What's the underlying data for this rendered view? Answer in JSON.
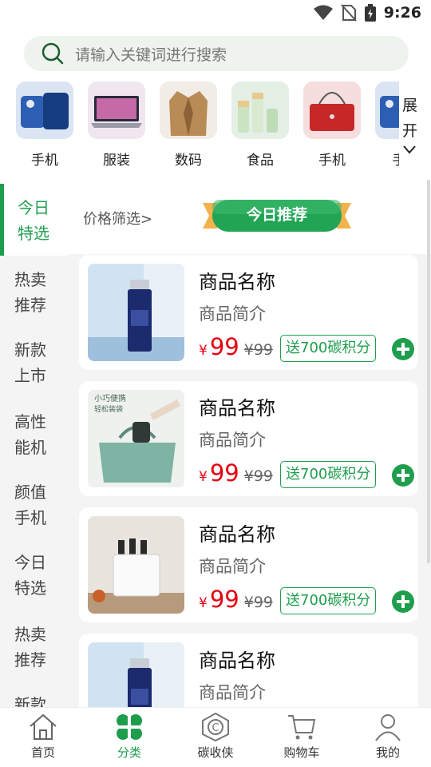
{
  "status_bar": {
    "time": "9:26"
  },
  "search": {
    "placeholder": "请输入关键词进行搜索"
  },
  "categories": [
    {
      "label": "手机",
      "icon": "phone-thumbnail"
    },
    {
      "label": "服装",
      "icon": "laptop-thumbnail"
    },
    {
      "label": "数码",
      "icon": "coat-thumbnail"
    },
    {
      "label": "食品",
      "icon": "cosmetics-thumbnail"
    },
    {
      "label": "手机",
      "icon": "handbag-thumbnail"
    },
    {
      "label": "手",
      "icon": "phone-thumbnail"
    }
  ],
  "expand": {
    "char1": "展",
    "char2": "开"
  },
  "side_menu": [
    {
      "label": "今日特选",
      "active": true
    },
    {
      "label": "热卖推荐"
    },
    {
      "label": "新款上市"
    },
    {
      "label": "高性能机"
    },
    {
      "label": "颜值手机"
    },
    {
      "label": "今日特选"
    },
    {
      "label": "热卖推荐"
    },
    {
      "label": "新款"
    }
  ],
  "filter": {
    "price_filter": "价格筛选>",
    "today_tag": "今日推荐"
  },
  "products": [
    {
      "name": "商品名称",
      "brief": "商品简介",
      "currency": "¥",
      "price": "99",
      "orig_price": "¥99",
      "badge": "送700碳积分",
      "image": "serum-bottle"
    },
    {
      "name": "商品名称",
      "brief": "商品简介",
      "currency": "¥",
      "price": "99",
      "orig_price": "¥99",
      "badge": "送700碳积分",
      "image": "green-handbag",
      "image_caption_1": "小巧便携",
      "image_caption_2": "轻松装袋"
    },
    {
      "name": "商品名称",
      "brief": "商品简介",
      "currency": "¥",
      "price": "99",
      "orig_price": "¥99",
      "badge": "送700碳积分",
      "image": "knife-sterilizer"
    },
    {
      "name": "商品名称",
      "brief": "商品简介",
      "currency": "¥",
      "price": "",
      "orig_price": "",
      "badge": "",
      "image": "serum-bottle"
    }
  ],
  "tabs": [
    {
      "label": "首页",
      "icon": "home-icon"
    },
    {
      "label": "分类",
      "icon": "clover-icon",
      "active": true
    },
    {
      "label": "碳收侠",
      "icon": "carbon-hexagon-icon"
    },
    {
      "label": "购物车",
      "icon": "cart-icon"
    },
    {
      "label": "我的",
      "icon": "profile-icon"
    }
  ],
  "colors": {
    "accent": "#1e9e4d",
    "price": "#e60012",
    "sidebar_bg": "#f4f4f4",
    "search_bg": "#eef3ee"
  }
}
